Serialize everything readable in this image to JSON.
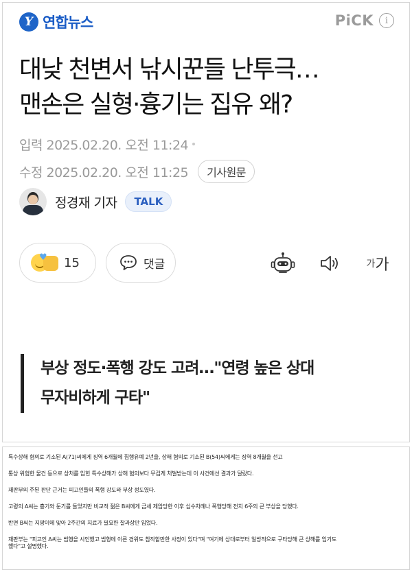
{
  "header": {
    "logo_mark": "Y",
    "logo_text": "연합뉴스",
    "pick_label": "PiCK",
    "info_label": "i"
  },
  "headline": {
    "line1": "대낮 천변서 낚시꾼들 난투극…",
    "line2": "맨손은 실형·흉기는 집유 왜?"
  },
  "dates": {
    "published": "입력 2025.02.20. 오전 11:24",
    "modified": "수정 2025.02.20. 오전 11:25",
    "original_button": "기사원문"
  },
  "reporter": {
    "name": "정경재 기자",
    "talk_label": "TALK"
  },
  "actions": {
    "reaction_count": "15",
    "comment_label": "댓글",
    "font_small": "가",
    "font_big": "가"
  },
  "subheadline": {
    "line1": "부상 정도·폭행 강도 고려…\"연령 높은 상대",
    "line2": "무자비하게 구타\""
  },
  "article": {
    "paragraphs": [
      "특수상해 혐의로 기소된 A(71)씨에게 징역 6개월에 집행유예 2년을, 상해 혐의로 기소된 B(54)씨에게는 징역 8개월을 선고",
      "통상 위험한 물건 등으로 상처를 입힌 특수상해가 상해 혐의보다 무겁게 처벌받는데 이 사건에선 결과가 달랐다.",
      "재판부의 주된 판단 근거는 피고인들의 폭행 강도와 부상 정도였다.",
      "고령의 A씨는 흉기와 둔기를 들었지만 비교적 젊은 B씨에게 금세 제압당한 이후 십수차례나 폭행당해 전치 6주의 큰 부상을 당했다.",
      "반면 B씨는 지팡이에 맞아 2주간의 치료가 필요한 찰과상만 입었다.",
      "재판부는 \"피고인 A씨는 범행을 시인했고 범행에 이른 경위도 참작할만한 사정이 있다\"며 \"여기에 상대로부터 일방적으로 구타당해 큰 상해를 입기도",
      "했다\"고 설명했다."
    ]
  },
  "colors": {
    "brand_blue": "#1a5cc6",
    "talk_blue": "#2b5fbf",
    "meta_gray": "#9a9a9a"
  },
  "icons": [
    "yonhap-logo-icon",
    "info-icon",
    "reaction-emoji-icon",
    "speech-bubble-icon",
    "robot-icon",
    "speaker-icon"
  ]
}
